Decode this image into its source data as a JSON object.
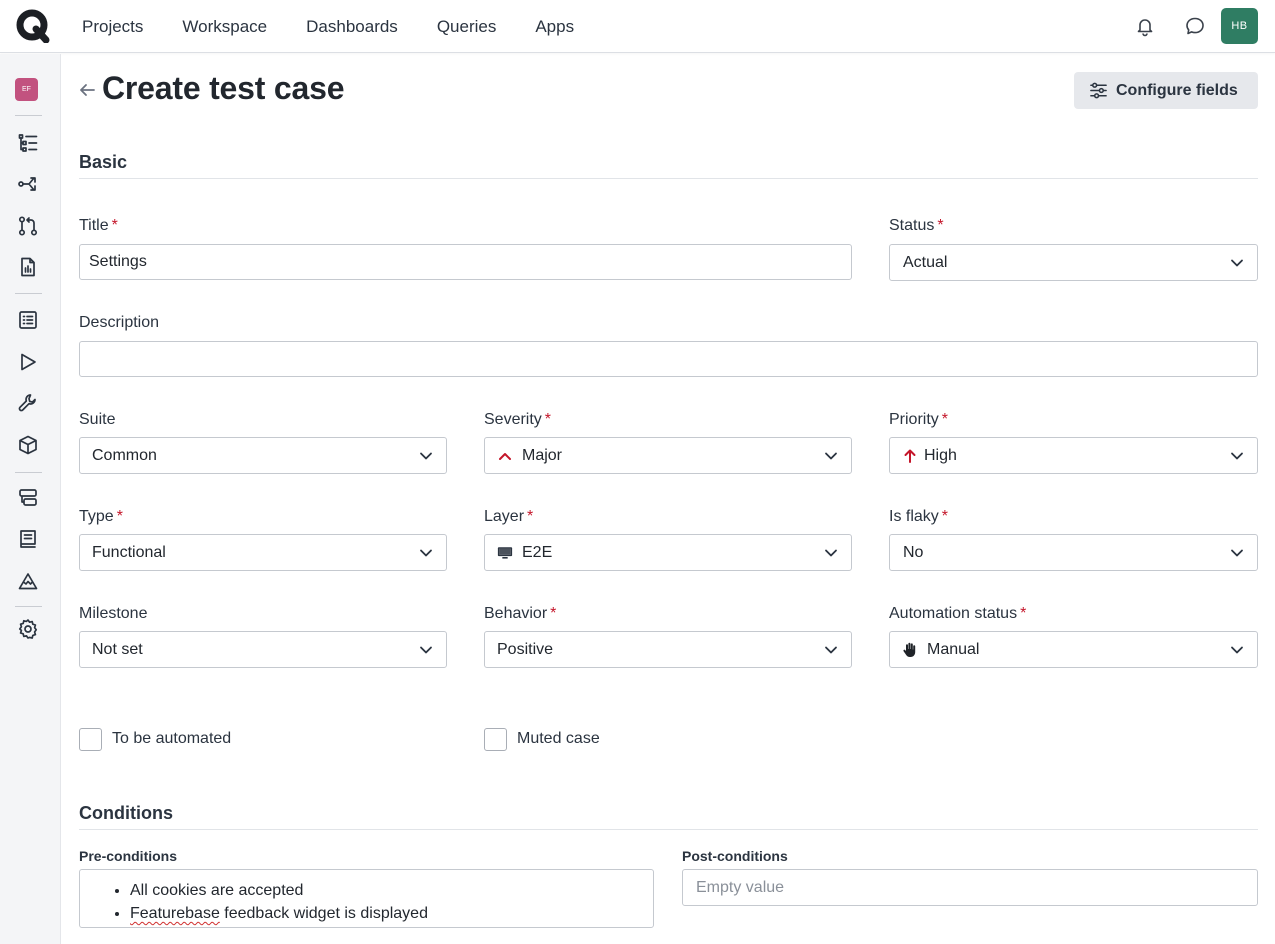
{
  "nav": {
    "items": [
      "Projects",
      "Workspace",
      "Dashboards",
      "Queries",
      "Apps"
    ]
  },
  "user": {
    "initials": "HB",
    "avatar_color": "#2f7d63"
  },
  "project": {
    "initials": "EF",
    "avatar_color": "#c2527f"
  },
  "sidebar": {
    "icons": [
      "repository-icon",
      "shared-steps-icon",
      "workflow-icon",
      "report-icon",
      "test-plans-icon",
      "test-runs-icon",
      "configurations-icon",
      "environments-icon",
      "defects-icon",
      "requirements-icon",
      "milestones-icon",
      "settings-icon"
    ]
  },
  "page": {
    "title": "Create test case",
    "configure_label": "Configure fields"
  },
  "sections": {
    "basic": "Basic",
    "conditions": "Conditions"
  },
  "required_mark": "*",
  "fields": {
    "title": {
      "label": "Title",
      "value": "Settings"
    },
    "status": {
      "label": "Status",
      "value": "Actual"
    },
    "description": {
      "label": "Description",
      "value": ""
    },
    "suite": {
      "label": "Suite",
      "value": "Common"
    },
    "severity": {
      "label": "Severity",
      "value": "Major",
      "icon": "chevron-up-icon"
    },
    "priority": {
      "label": "Priority",
      "value": "High",
      "icon": "arrow-up-icon"
    },
    "type": {
      "label": "Type",
      "value": "Functional"
    },
    "layer": {
      "label": "Layer",
      "value": "E2E",
      "icon": "monitor-icon"
    },
    "is_flaky": {
      "label": "Is flaky",
      "value": "No"
    },
    "milestone": {
      "label": "Milestone",
      "value": "Not set"
    },
    "behavior": {
      "label": "Behavior",
      "value": "Positive"
    },
    "automation_status": {
      "label": "Automation status",
      "value": "Manual",
      "icon": "hand-icon"
    }
  },
  "checkboxes": {
    "to_be_automated": {
      "label": "To be automated",
      "checked": false
    },
    "muted_case": {
      "label": "Muted case",
      "checked": false
    }
  },
  "conditions": {
    "pre_label": "Pre-conditions",
    "pre_items": [
      "All cookies are accepted",
      "Featurebase",
      " feedback widget is displayed"
    ],
    "post_label": "Post-conditions",
    "post_placeholder": "Empty value"
  },
  "colors": {
    "required": "#c4162a",
    "severity_icon": "#c4162a",
    "priority_icon": "#c4162a"
  }
}
